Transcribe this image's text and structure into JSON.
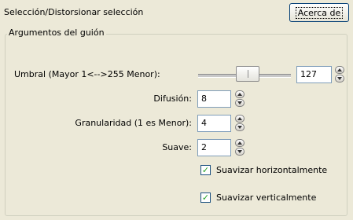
{
  "header": {
    "title": "Selección/Distorsionar selección",
    "about_button": "Acerca de"
  },
  "group": {
    "legend": "Argumentos del guión",
    "threshold": {
      "label": "Umbral (Mayor 1<-->255 Menor):",
      "value": "127",
      "slider_level": 0.5
    },
    "diffusion": {
      "label": "Difusión:",
      "value": "8"
    },
    "granularity": {
      "label": "Granularidad (1 es Menor):",
      "value": "4"
    },
    "smooth": {
      "label": "Suave:",
      "value": "2"
    },
    "smooth_horizontal": {
      "label": "Suavizar horizontalmente",
      "checked": true
    },
    "smooth_vertical": {
      "label": "Suavizar verticalmente",
      "checked": true
    }
  },
  "icons": {
    "check": "checkmark-icon",
    "spin_up": "arrow-up-icon",
    "spin_down": "arrow-down-icon"
  },
  "colors": {
    "panel_bg": "#ece9d8",
    "input_border": "#7f9db9",
    "check_green": "#21a121"
  }
}
